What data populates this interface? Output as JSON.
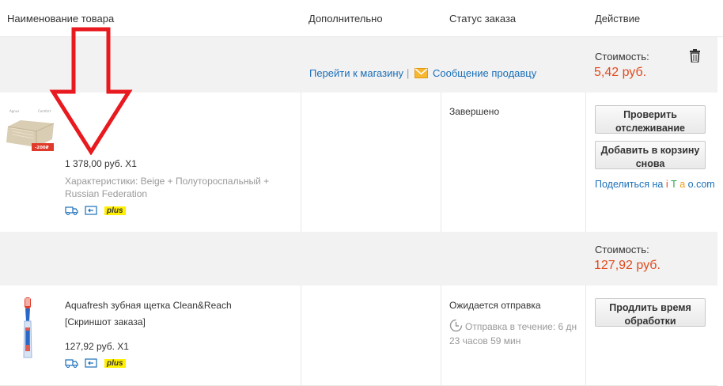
{
  "header": {
    "col_product": "Наименование товара",
    "col_additional": "Дополнительно",
    "col_status": "Статус заказа",
    "col_action": "Действие"
  },
  "order1": {
    "store_link": "Перейти к магазину",
    "separator": "|",
    "message_link": "Сообщение продавцу",
    "cost_label": "Стоимость:",
    "cost_value": "5,42 руб.",
    "thumb_badge": "-200₽",
    "thumb_brand1": "Agnus",
    "thumb_brand2": "Comfort",
    "price_line": "1 378,00 руб. X1",
    "specs": "Характеристики: Beige + Полутороспальный + Russian Federation",
    "plus_badge": "plus",
    "status": "Завершено",
    "btn_track": "Проверить отслеживание",
    "btn_readd": "Добавить в корзину снова",
    "share_prefix": "Поделиться на ",
    "share_i": "i",
    "share_t": "T",
    "share_a": "a",
    "share_o": "o",
    "share_suffix": ".com"
  },
  "order2": {
    "cost_label": "Стоимость:",
    "cost_value": "127,92 руб.",
    "title": "Aquafresh зубная щетка Clean&Reach",
    "snapshot": "[Скриншот заказа]",
    "price_line": "127,92 руб. X1",
    "plus_badge": "plus",
    "status": "Ожидается отправка",
    "ship_text": "Отправка в течение: 6 дн 23 часов 59 мин",
    "btn_extend": "Продлить время обработки"
  },
  "colors": {
    "accent_red": "#e14b1f",
    "link_blue": "#1a6fb8",
    "arrow_red": "#e8191f",
    "plus_yellow": "#ffef00"
  }
}
